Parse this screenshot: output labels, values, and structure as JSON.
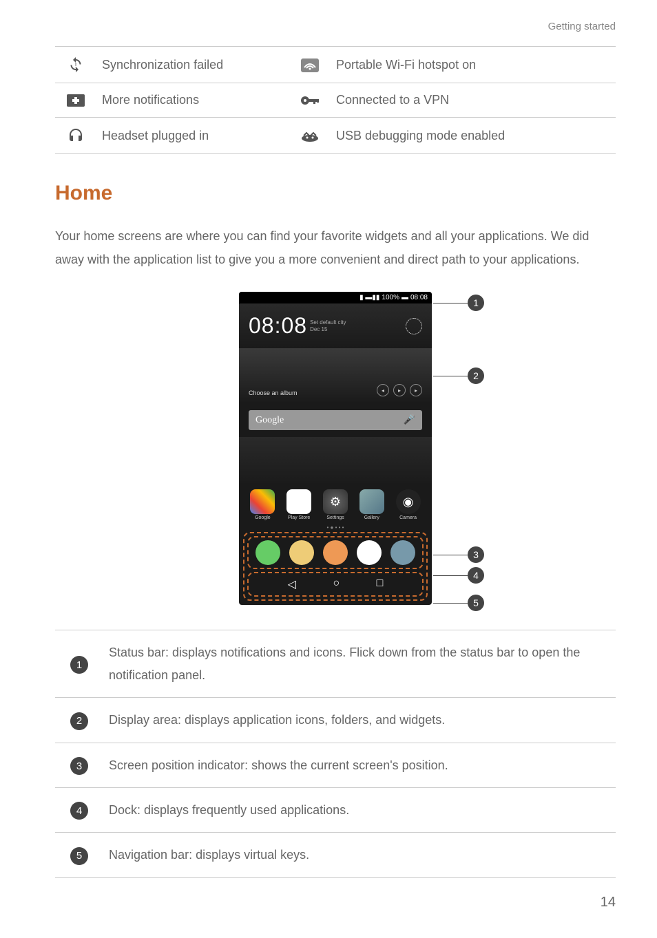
{
  "header": {
    "section": "Getting started"
  },
  "icon_rows": [
    {
      "left_desc": "Synchronization failed",
      "right_desc": "Portable Wi-Fi hotspot on"
    },
    {
      "left_desc": "More notifications",
      "right_desc": "Connected to a VPN"
    },
    {
      "left_desc": "Headset plugged in",
      "right_desc": "USB debugging mode enabled"
    }
  ],
  "title": "Home",
  "intro": "Your home screens are where you can find your favorite widgets and all your applications. We did away with the application list to give you a more convenient and direct path to your applications.",
  "phone": {
    "status_text": "100%",
    "status_time": "08:08",
    "clock_time": "08:08",
    "clock_city": "Set default city",
    "clock_date": "Dec 15",
    "music_label": "Choose an album",
    "google_label": "Google",
    "apps": [
      {
        "label": "Google"
      },
      {
        "label": "Play Store"
      },
      {
        "label": "Settings"
      },
      {
        "label": "Gallery"
      },
      {
        "label": "Camera"
      }
    ]
  },
  "callouts": [
    "1",
    "2",
    "3",
    "4",
    "5"
  ],
  "legend": [
    {
      "n": "1",
      "text": "Status bar: displays notifications and icons. Flick down from the status bar to open the notification panel."
    },
    {
      "n": "2",
      "text": "Display area: displays application icons, folders, and widgets."
    },
    {
      "n": "3",
      "text": "Screen position indicator: shows the current screen's position."
    },
    {
      "n": "4",
      "text": "Dock: displays frequently used applications."
    },
    {
      "n": "5",
      "text": "Navigation bar: displays virtual keys."
    }
  ],
  "page_number": "14"
}
